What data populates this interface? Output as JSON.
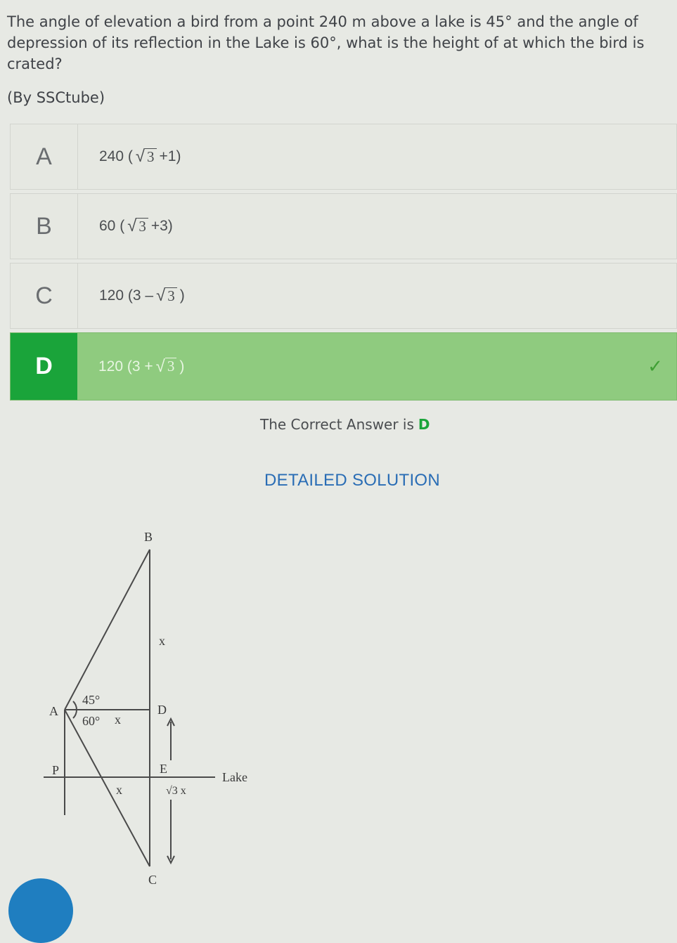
{
  "question": {
    "text": "The angle of elevation a bird from a point 240 m above a lake is 45° and the angle of depression of its reflection in the Lake is 60°, what is the height of at which the bird is crated?",
    "source": "(By SSCtube)"
  },
  "options": [
    {
      "letter": "A",
      "prefix": "240 (",
      "radicand": "3",
      "suffix": "+1)"
    },
    {
      "letter": "B",
      "prefix": "60 (",
      "radicand": "3",
      "suffix": "+3)"
    },
    {
      "letter": "C",
      "prefix": "120 (3 –",
      "radicand": "3",
      "suffix": ")"
    },
    {
      "letter": "D",
      "prefix": "120 (3 +",
      "radicand": "3",
      "suffix": ")"
    }
  ],
  "correct": {
    "check_icon": "checkmark-icon",
    "answer_label": "The Correct Answer is",
    "answer_letter": "D"
  },
  "solution": {
    "heading": "DETAILED SOLUTION",
    "diagram": {
      "point_B": "B",
      "point_A": "A",
      "point_D": "D",
      "point_P": "P",
      "point_E": "E",
      "point_C": "C",
      "angle_elevation": "45°",
      "angle_depression": "60°",
      "label_AD": "x",
      "label_BD": "x",
      "label_bottom": "x",
      "label_root_x": "√3 x",
      "label_lake": "Lake"
    }
  },
  "colors": {
    "correct_bg": "#8fcb7f",
    "correct_letter_bg": "#1aa43a",
    "heading_blue": "#2a6db5",
    "fab_blue": "#1f7ec0"
  }
}
